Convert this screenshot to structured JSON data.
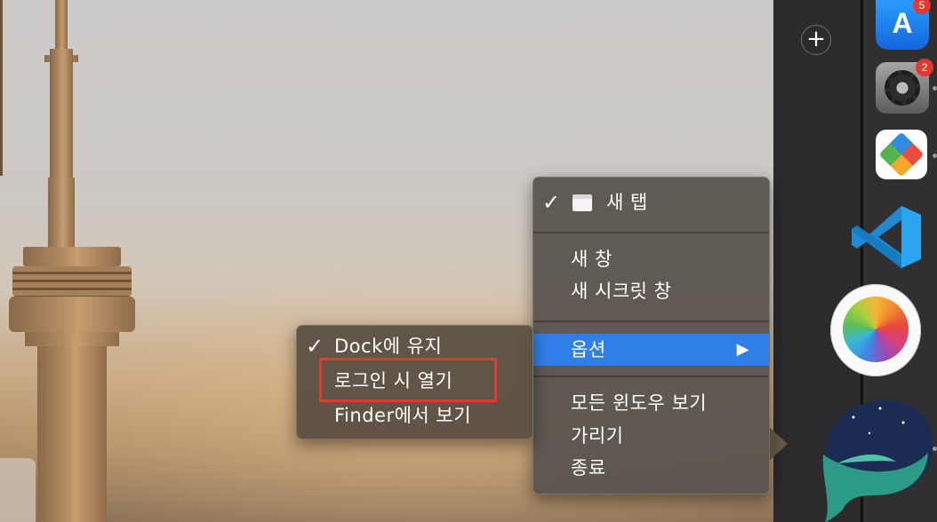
{
  "main_menu": {
    "items": [
      {
        "label": "새 탭",
        "checked": true
      },
      {
        "label": "새 창"
      },
      {
        "label": "새 시크릿 창"
      },
      {
        "label": "옵션",
        "highlighted": true,
        "submenu_arrow": "▶"
      },
      {
        "label": "모든 윈도우 보기"
      },
      {
        "label": "가리기"
      },
      {
        "label": "종료"
      }
    ]
  },
  "options_submenu": {
    "items": [
      {
        "label": "Dock에 유지",
        "checked": true
      },
      {
        "label": "로그인 시 열기",
        "annotated": true
      },
      {
        "label": "Finder에서 보기"
      }
    ]
  },
  "side_panel": {
    "add_button": "+"
  },
  "dock": {
    "apps": [
      {
        "name": "app-store-icon",
        "badge": "5"
      },
      {
        "name": "system-preferences-icon",
        "badge": "2"
      },
      {
        "name": "multi-app-icon"
      },
      {
        "name": "vscode-icon"
      },
      {
        "name": "photos-icon"
      },
      {
        "name": "whale-browser-icon"
      }
    ]
  },
  "colors": {
    "menu_highlight": "#2f80e8",
    "annotation_box": "#e23a2e",
    "badge": "#e2382f"
  },
  "glyphs": {
    "check": "✓",
    "app_store": "A"
  }
}
